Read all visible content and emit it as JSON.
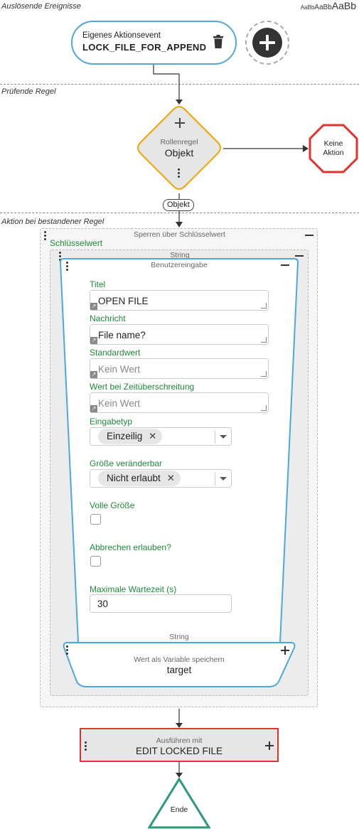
{
  "sections": {
    "trigger_label": "Auslösende Ereignisse",
    "check_label": "Prüfende Regel",
    "action_label": "Aktion bei bestandener Regel"
  },
  "font_size_sample": "AaBbAaBbAaBb",
  "trigger": {
    "caption": "Eigenes Aktionsevent",
    "name": "LOCK_FILE_FOR_APPEND"
  },
  "rule": {
    "caption": "Rollenregel",
    "name": "Objekt",
    "edge_label": "Objekt",
    "no_action": "Keine Aktion"
  },
  "lock": {
    "caption": "Sperren über Schlüsselwert",
    "key_label": "Schlüsselwert",
    "string_caption": "String"
  },
  "input": {
    "caption": "Benutzereingabe",
    "title_label": "Titel",
    "title_value": "OPEN FILE",
    "message_label": "Nachricht",
    "message_value": "File name?",
    "default_label": "Standardwert",
    "default_placeholder": "Kein Wert",
    "timeout_value_label": "Wert bei Zeitüberschreitung",
    "timeout_value_placeholder": "Kein Wert",
    "input_type_label": "Eingabetyp",
    "input_type_value": "Einzeilig",
    "resizable_label": "Größe veränderbar",
    "resizable_value": "Nicht erlaubt",
    "fullsize_label": "Volle Größe",
    "cancel_label": "Abbrechen erlauben?",
    "max_wait_label": "Maximale Wartezeit (s)",
    "max_wait_value": "30",
    "result_type": "String",
    "save_var_caption": "Wert als Variable speichern",
    "save_var_value": "target"
  },
  "execute": {
    "caption": "Ausführen mit",
    "name": "EDIT LOCKED FILE"
  },
  "end": {
    "label": "Ende"
  },
  "colors": {
    "blue_border": "#4fa8d8",
    "orange": "#f0a500",
    "red": "#e0332e",
    "green": "#2a9a78",
    "label_green": "#1f8a3a"
  }
}
